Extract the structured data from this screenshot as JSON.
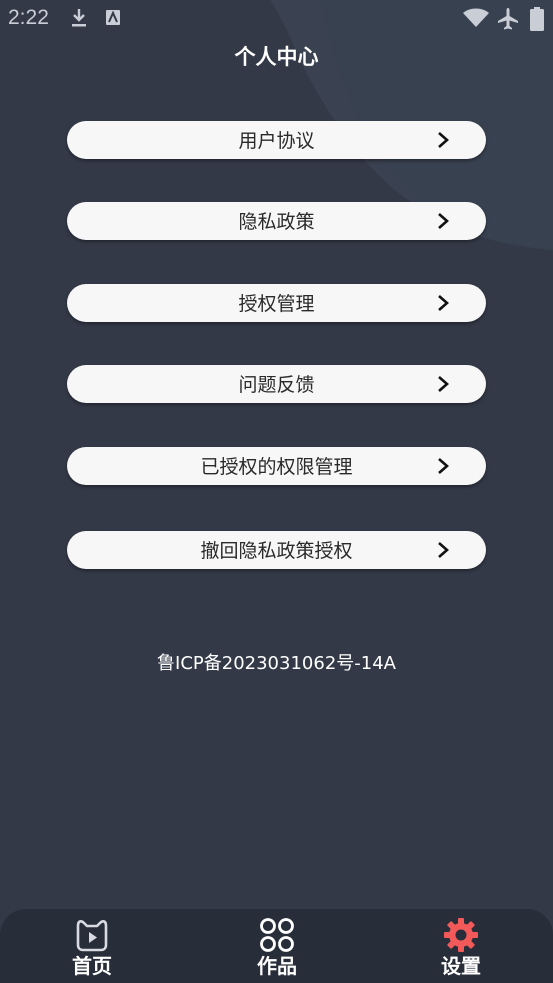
{
  "status_bar": {
    "time": "2:22",
    "icons": [
      "download-icon",
      "notification-icon",
      "wifi-icon",
      "airplane-mode-icon",
      "battery-icon"
    ]
  },
  "header": {
    "title": "个人中心"
  },
  "menu": {
    "items": [
      {
        "label": "用户协议"
      },
      {
        "label": "隐私政策"
      },
      {
        "label": "授权管理"
      },
      {
        "label": "问题反馈"
      },
      {
        "label": "已授权的权限管理"
      },
      {
        "label": "撤回隐私政策授权"
      }
    ]
  },
  "footer": {
    "icp": "鲁ICP备2023031062号-14A"
  },
  "tabbar": {
    "tabs": [
      {
        "label": "首页",
        "icon": "play-video-icon",
        "active": false
      },
      {
        "label": "作品",
        "icon": "grid-circles-icon",
        "active": false
      },
      {
        "label": "设置",
        "icon": "gear-icon",
        "active": true
      }
    ]
  },
  "colors": {
    "background": "#333947",
    "background_shape": "#3a4150",
    "menu_item_bg": "#f7f7f8",
    "tabbar_bg": "#272d39",
    "active_tab_icon": "#f25a5a"
  }
}
